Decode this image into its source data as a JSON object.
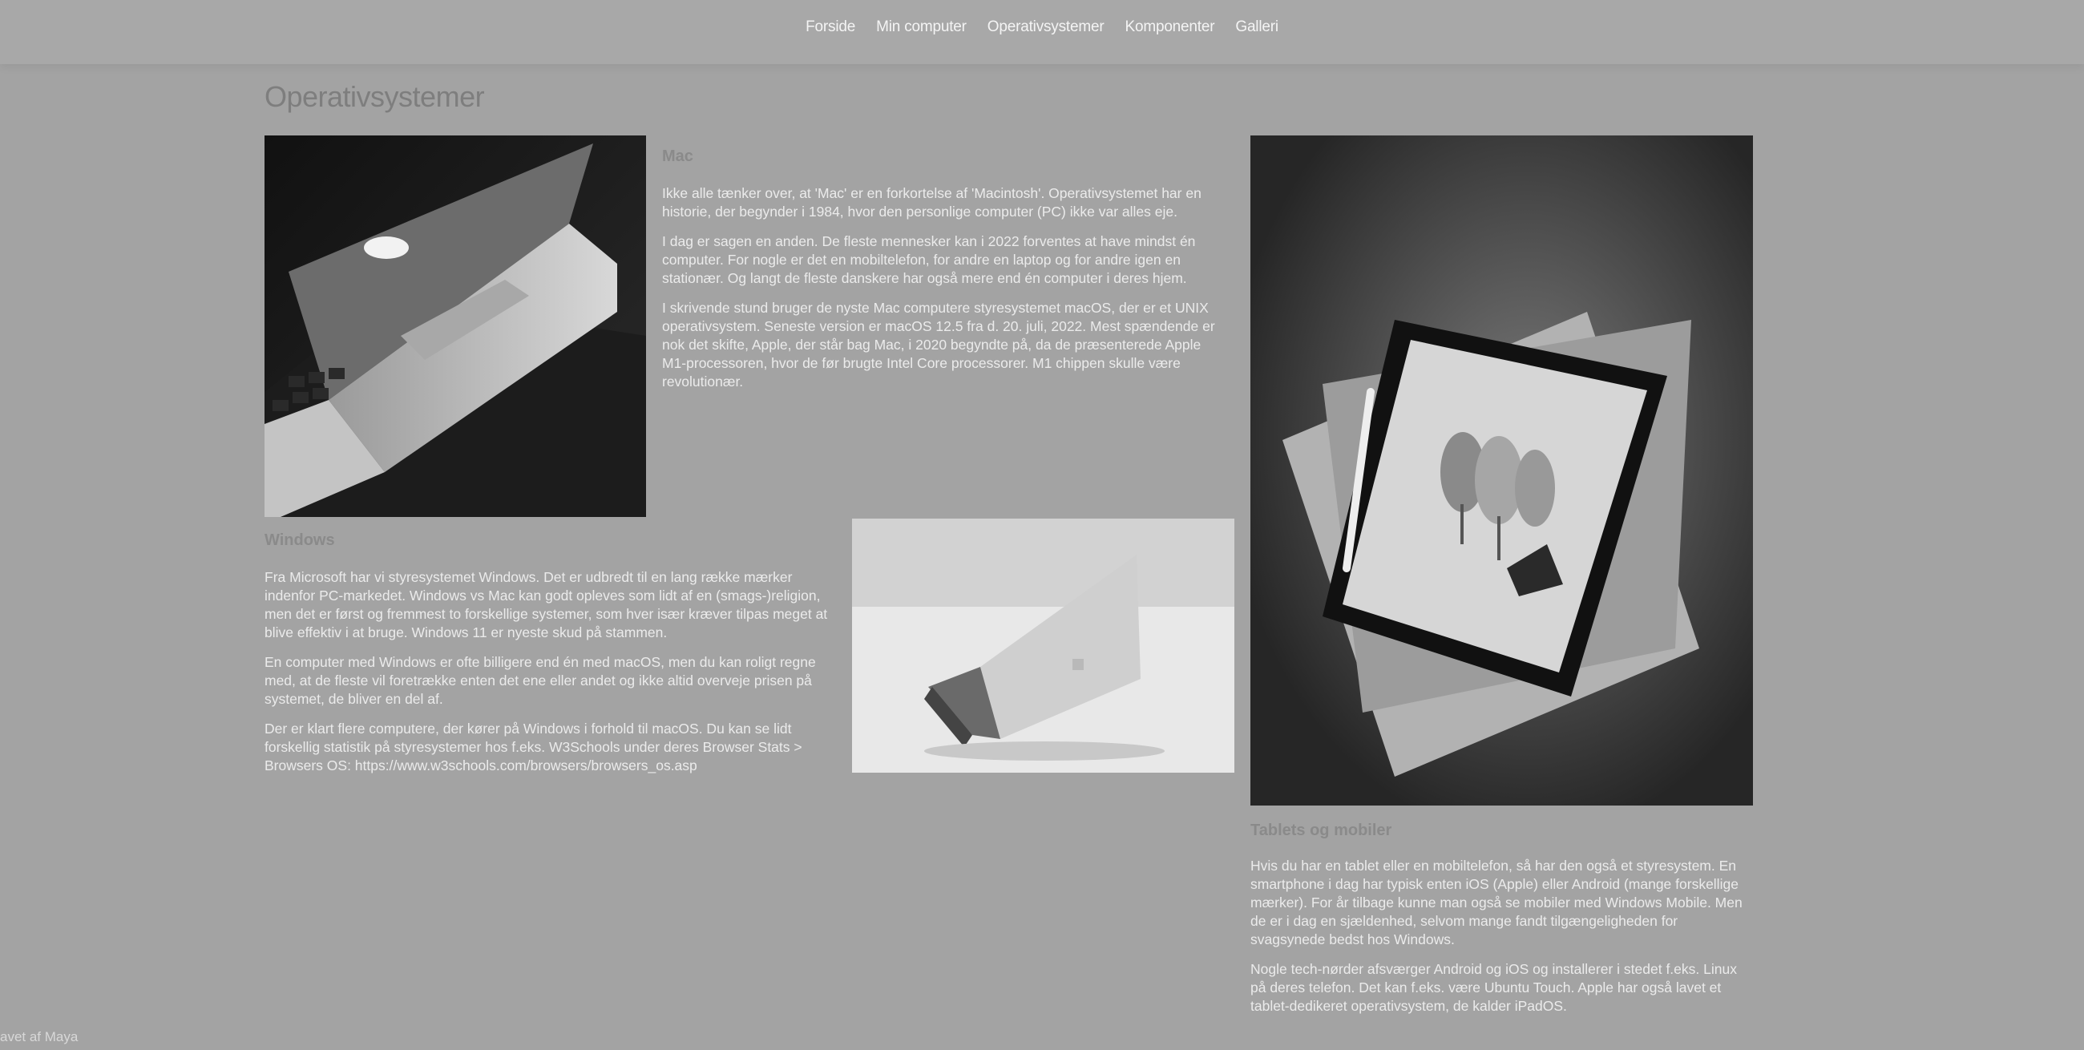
{
  "nav": {
    "items": [
      {
        "label": "Forside"
      },
      {
        "label": "Min computer"
      },
      {
        "label": "Operativsystemer"
      },
      {
        "label": "Komponenter"
      },
      {
        "label": "Galleri"
      }
    ]
  },
  "page_title": "Operativsystemer",
  "mac": {
    "title": "Mac",
    "paragraphs": [
      "Ikke alle tænker over, at 'Mac' er en forkortelse af 'Macintosh'. Operativsystemet har en historie, der begynder i 1984, hvor den personlige computer (PC) ikke var alles eje.",
      "I dag er sagen en anden. De fleste mennesker kan i 2022 forventes at have mindst én computer. For nogle er det en mobiltelefon, for andre en laptop og for andre igen en stationær. Og langt de fleste danskere har også mere end én computer i deres hjem.",
      "I skrivende stund bruger de nyste Mac computere styresystemet macOS, der er et UNIX operativsystem. Seneste version er macOS 12.5 fra d. 20. juli, 2022. Mest spændende er nok det skifte, Apple, der står bag Mac, i 2020 begyndte på, da de præsenterede Apple M1-processoren, hvor de før brugte Intel Core processorer. M1 chippen skulle være revolutionær."
    ]
  },
  "windows": {
    "title": "Windows",
    "paragraphs": [
      "Fra Microsoft har vi styresystemet Windows. Det er udbredt til en lang række mærker indenfor PC-markedet. Windows vs Mac kan godt opleves som lidt af en (smags-)religion, men det er først og fremmest to forskellige systemer, som hver især kræver tilpas meget at blive effektiv i at bruge. Windows 11 er nyeste skud på stammen.",
      "En computer med Windows er ofte billigere end én med macOS, men du kan roligt regne med, at de fleste vil foretrække enten det ene eller andet og ikke altid overveje prisen på systemet, de bliver en del af.",
      "Der er klart flere computere, der kører på Windows i forhold til macOS. Du kan se lidt forskellig statistik på styresystemer hos f.eks. W3Schools under deres Browser Stats > Browsers OS: https://www.w3schools.com/browsers/browsers_os.asp"
    ]
  },
  "tablets": {
    "title": "Tablets og mobiler",
    "paragraphs": [
      "Hvis du har en tablet eller en mobiltelefon, så har den også et styresystem. En smartphone i dag har typisk enten iOS (Apple) eller Android (mange forskellige mærker). For år tilbage kunne man også se mobiler med Windows Mobile. Men de er i dag en sjældenhed, selvom mange fandt tilgængeligheden for svagsynede bedst hos Windows.",
      "Nogle tech-nørder afsværger Android og iOS og installerer i stedet f.eks. Linux på deres telefon. Det kan f.eks. være Ubuntu Touch. Apple har også lavet et tablet-dedikeret operativsystem, de kalder iPadOS."
    ]
  },
  "footer": "avet af Maya"
}
